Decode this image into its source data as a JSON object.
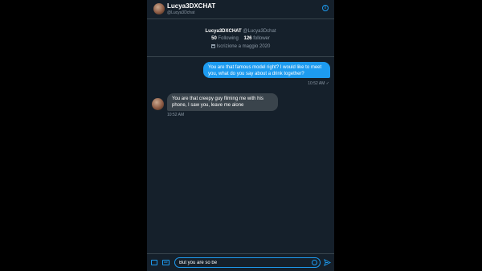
{
  "header": {
    "name": "Lucya3DXCHAT",
    "handle": "@Lucya3Dchat"
  },
  "profile": {
    "name": "Lucya3DXCHAT",
    "handle": "@Lucya3Dchat",
    "following_count": "50",
    "following_label": "Following",
    "follower_count": "126",
    "follower_label": "follower",
    "joined": "Iscrizione a maggio 2020"
  },
  "messages": [
    {
      "text": "You are that famous model right? I would like to meet you, what do you say about a drink together?",
      "time": "10:52 AM ✓"
    },
    {
      "text": "You are that creepy guy filming me with his phone, I saw you, leave me alone",
      "time": "10:52 AM"
    }
  ],
  "composer": {
    "value": "But you are so be"
  },
  "colors": {
    "accent": "#1d9bf0",
    "background": "#15202b",
    "incoming_bubble": "#3a444c"
  }
}
